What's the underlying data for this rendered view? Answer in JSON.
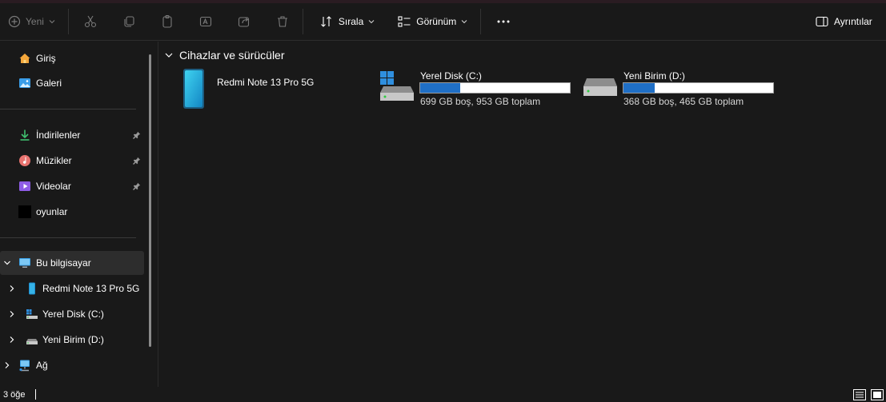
{
  "toolbar": {
    "new_label": "Yeni",
    "sort_label": "Sırala",
    "view_label": "Görünüm",
    "details_label": "Ayrıntılar"
  },
  "sidebar": {
    "items": [
      {
        "label": "Giriş",
        "icon": "home-icon"
      },
      {
        "label": "Galeri",
        "icon": "gallery-icon"
      },
      {
        "label": "İndirilenler",
        "icon": "download-icon",
        "pinned": true
      },
      {
        "label": "Müzikler",
        "icon": "music-icon",
        "pinned": true
      },
      {
        "label": "Videolar",
        "icon": "video-icon",
        "pinned": true
      },
      {
        "label": "oyunlar",
        "icon": "folder-icon"
      }
    ],
    "tree": [
      {
        "label": "Bu bilgisayar",
        "icon": "computer-icon",
        "expanded": true,
        "selected": true
      },
      {
        "label": "Redmi Note 13 Pro 5G",
        "icon": "phone-icon"
      },
      {
        "label": "Yerel Disk (C:)",
        "icon": "windows-drive-icon"
      },
      {
        "label": "Yeni Birim (D:)",
        "icon": "drive-icon"
      },
      {
        "label": "Ağ",
        "icon": "network-icon"
      }
    ]
  },
  "main": {
    "group_title": "Cihazlar ve sürücüler",
    "devices": [
      {
        "name": "Redmi Note 13 Pro 5G",
        "icon": "phone-icon"
      },
      {
        "name": "Yerel Disk (C:)",
        "icon": "windows-drive-icon",
        "usage_fraction": 0.266,
        "detail": "699 GB boş, 953 GB toplam"
      },
      {
        "name": "Yeni Birim (D:)",
        "icon": "drive-icon",
        "usage_fraction": 0.209,
        "detail": "368 GB boş, 465 GB toplam"
      }
    ]
  },
  "status": {
    "item_count": "3 öğe"
  },
  "colors": {
    "background": "#191919",
    "accent": "#1f6fc6",
    "selection": "#2d2d2d"
  }
}
